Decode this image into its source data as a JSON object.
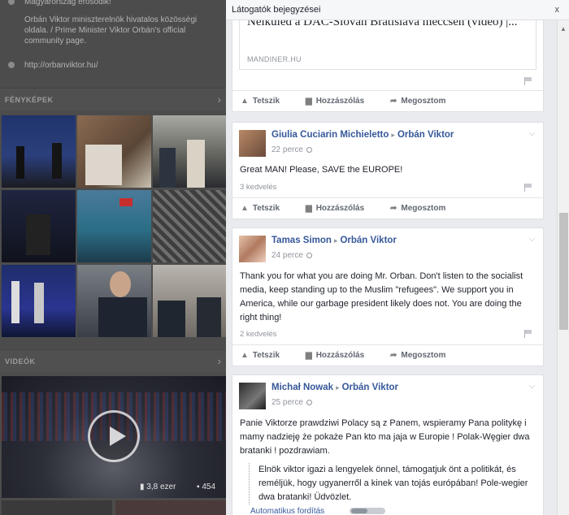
{
  "left_page": {
    "intro_line1": "Magyarország érősödik!",
    "intro_line2": "Orbán Viktor miniszterelnök hivatalos közösségi oldala. / Prime Minister Viktor Orbán's official community page.",
    "website": "http://orbanviktor.hu/",
    "photos_title": "FÉNYKÉPEK",
    "videos_title": "VIDEÓK",
    "video_views": "3,8 ezer",
    "video_count_partial": "454"
  },
  "dialog": {
    "title": "Látogatók bejegyzései",
    "close_label": "x",
    "actions": {
      "like": "Tetszik",
      "comment": "Hozzászólás",
      "share": "Megosztom"
    }
  },
  "posts": [
    {
      "link_title": "Nélküled a DAC-Slovan Bratislava meccsen (videó) |...",
      "link_source": "MANDINER.HU"
    },
    {
      "author": "Giulia Cuciarin Michieletto",
      "target": "Orbán Viktor",
      "time": "22 perce",
      "text": "Great MAN! Please, SAVE the EUROPE!",
      "likes": "3 kedvelés"
    },
    {
      "author": "Tamas Simon",
      "target": "Orbán Viktor",
      "time": "24 perce",
      "text": "Thank you for what you are doing Mr. Orban. Don't listen to the socialist media, keep standing up to the Muslim \"refugees\". We support you in America, while our garbage president likely does not. You are doing the right thing!",
      "likes": "2 kedvelés"
    },
    {
      "author": "Michał Nowak",
      "target": "Orbán Viktor",
      "time": "25 perce",
      "text": "Panie Viktorze prawdziwi Polacy są z Panem, wspieramy Pana politykę i mamy nadzieję że pokaże Pan kto ma jaja w Europie ! Polak-Węgier dwa bratanki ! pozdrawiam.",
      "translation": "Elnök viktor igazi a lengyelek önnel, támogatjuk önt a politikát, és reméljük, hogy ugyanerről a kinek van tojás európában! Pole-wegier dwa bratanki! Üdvözlet.",
      "auto_translate_label": "Automatikus fordítás"
    }
  ],
  "colors": {
    "link_blue": "#365899",
    "overlay": "#4c4c4c",
    "dialog_bg": "#e9ebee"
  }
}
